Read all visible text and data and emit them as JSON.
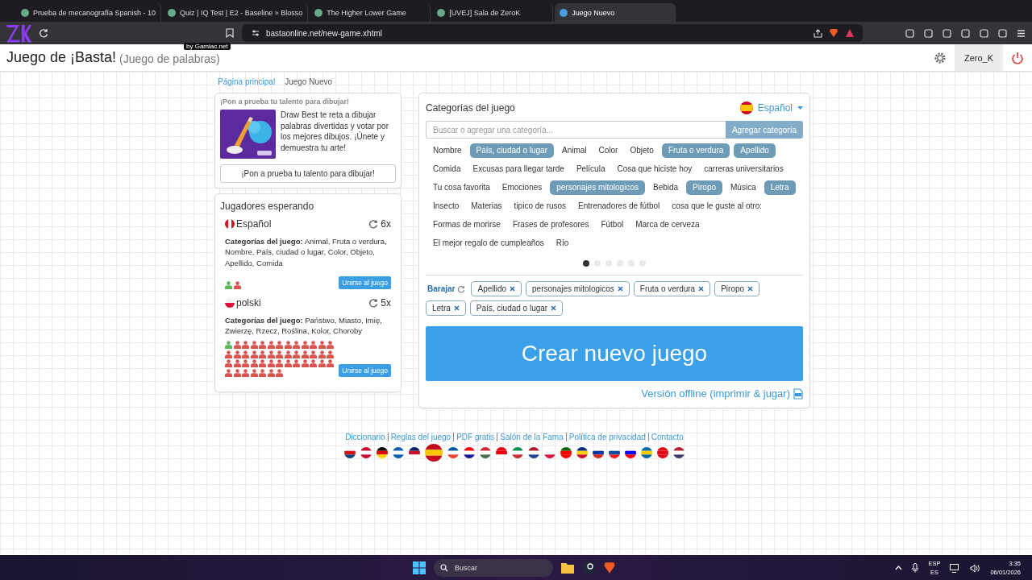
{
  "browser": {
    "tabs": [
      {
        "title": "Prueba de mecanografía Spanish - 10",
        "selected": false
      },
      {
        "title": "Quiz | IQ Test | E2 - Baseline » Blosso",
        "selected": false
      },
      {
        "title": "The Higher Lower Game",
        "selected": false
      },
      {
        "title": "[UVEJ] Sala de ZeroK",
        "selected": false
      },
      {
        "title": "Juego Nuevo",
        "selected": true
      }
    ],
    "url": "bastaonline.net/new-game.xhtml"
  },
  "header": {
    "title": "Juego de ¡Basta!",
    "subtitle": "(Juego de palabras)",
    "badge": "by Gamiac.net",
    "user": "Zero_K"
  },
  "breadcrumb": [
    {
      "label": "Página principal",
      "kind": "link"
    },
    {
      "label": "Juego Nuevo",
      "kind": "current"
    }
  ],
  "promo": {
    "heading": "¡Pon a prueba tu talento para dibujar!",
    "text": "Draw Best te reta a dibujar palabras divertidas y votar por los mejores dibujos. ¡Únete y demuestra tu arte!",
    "button": "¡Pon a prueba tu talento para dibujar!"
  },
  "waiting": {
    "title": "Jugadores esperando",
    "games": [
      {
        "language": "Español",
        "kind": "peru",
        "count": "6x",
        "categories": "**Categorías del juego:** Animal, Fruta o verdura, Nombre, País, ciudad o lugar, Color, Objeto, Apellido, Comida",
        "players": [
          true,
          false
        ],
        "button": "Unirse al juego"
      },
      {
        "language": "polski",
        "kind": "poland",
        "count": "5x",
        "categories": "**Categorías del juego:** Państwo, Miasto, Imię, Zwierzę, Rzecz, Roślina, Kolor, Choroby",
        "players": [
          true,
          false,
          false,
          false,
          false,
          false,
          false,
          false,
          false,
          false,
          false,
          false,
          false,
          false,
          false,
          false,
          false,
          false,
          false,
          false,
          false,
          false,
          false,
          false,
          false,
          false,
          false,
          false,
          false,
          false,
          false,
          false,
          false,
          false,
          false,
          false,
          false,
          false,
          false,
          false,
          false,
          false,
          false,
          false,
          false,
          false
        ],
        "button": "Unirse al juego"
      }
    ]
  },
  "categories": {
    "title": "Categorías del juego",
    "language": "Español",
    "search": {
      "placeholder": "Buscar o agregar una categoría..."
    },
    "add_button": "Agregar categoría",
    "items": [
      {
        "label": "Nombre",
        "selected": false
      },
      {
        "label": "País, ciudad o lugar",
        "selected": true
      },
      {
        "label": "Animal",
        "selected": false
      },
      {
        "label": "Color",
        "selected": false
      },
      {
        "label": "Objeto",
        "selected": false
      },
      {
        "label": "Fruta o verdura",
        "selected": true
      },
      {
        "label": "Apellido",
        "selected": true
      },
      {
        "label": "Comida",
        "selected": false
      },
      {
        "label": "Excusas para llegar tarde",
        "selected": false
      },
      {
        "label": "Película",
        "selected": false
      },
      {
        "label": "Cosa que hiciste hoy",
        "selected": false
      },
      {
        "label": "carreras universitarios",
        "selected": false
      },
      {
        "label": "Tu cosa favorita",
        "selected": false
      },
      {
        "label": "Emociones",
        "selected": false
      },
      {
        "label": "personajes mitologicos",
        "selected": true
      },
      {
        "label": "Bebida",
        "selected": false
      },
      {
        "label": "Piropo",
        "selected": true
      },
      {
        "label": "Música",
        "selected": false
      },
      {
        "label": "Letra",
        "selected": true
      },
      {
        "label": "Insecto",
        "selected": false
      },
      {
        "label": "Materias",
        "selected": false
      },
      {
        "label": "tipico de rusos",
        "selected": false
      },
      {
        "label": "Entrenadores de fútbol",
        "selected": false
      },
      {
        "label": "cosa que le guste al otro:",
        "selected": false
      },
      {
        "label": "Formas de morirse",
        "selected": false
      },
      {
        "label": "Frases de profesores",
        "selected": false
      },
      {
        "label": "Fútbol",
        "selected": false
      },
      {
        "label": "Marca de cerveza",
        "selected": false
      },
      {
        "label": "El mejor regalo de cumpleaños",
        "selected": false
      },
      {
        "label": "Río",
        "selected": false
      }
    ],
    "pages": [
      {
        "selected": true
      },
      {
        "selected": false
      },
      {
        "selected": false
      },
      {
        "selected": false
      },
      {
        "selected": false
      },
      {
        "selected": false
      }
    ],
    "shuffle": "Barajar",
    "chosen": [
      "Apellido",
      "personajes mitologicos",
      "Fruta o verdura",
      "Piropo",
      "Letra",
      "País, ciudad o lugar"
    ],
    "create_button": "Crear nuevo juego",
    "offline_link": "Versión offline (imprimir & jugar)"
  },
  "footer": {
    "links": [
      "Diccionario",
      "Reglas del juego",
      "PDF gratis",
      "Salón de la Fama",
      "Política de privacidad",
      "Contacto"
    ],
    "flags": [
      {
        "selected": false
      },
      {
        "selected": false
      },
      {
        "selected": false
      },
      {
        "selected": false
      },
      {
        "selected": false
      },
      {
        "selected": true
      },
      {
        "selected": false
      },
      {
        "selected": false
      },
      {
        "selected": false
      },
      {
        "selected": false
      },
      {
        "selected": false
      },
      {
        "selected": false
      },
      {
        "selected": false
      },
      {
        "selected": false
      },
      {
        "selected": false
      },
      {
        "selected": false
      },
      {
        "selected": false
      },
      {
        "selected": false
      },
      {
        "selected": false
      },
      {
        "selected": false
      },
      {
        "selected": false
      }
    ]
  },
  "taskbar": {
    "search": {
      "placeholder": "Buscar"
    },
    "lang_top": "ESP",
    "lang_bottom": "ES",
    "time": "3:35",
    "date": "06/01/2026"
  }
}
